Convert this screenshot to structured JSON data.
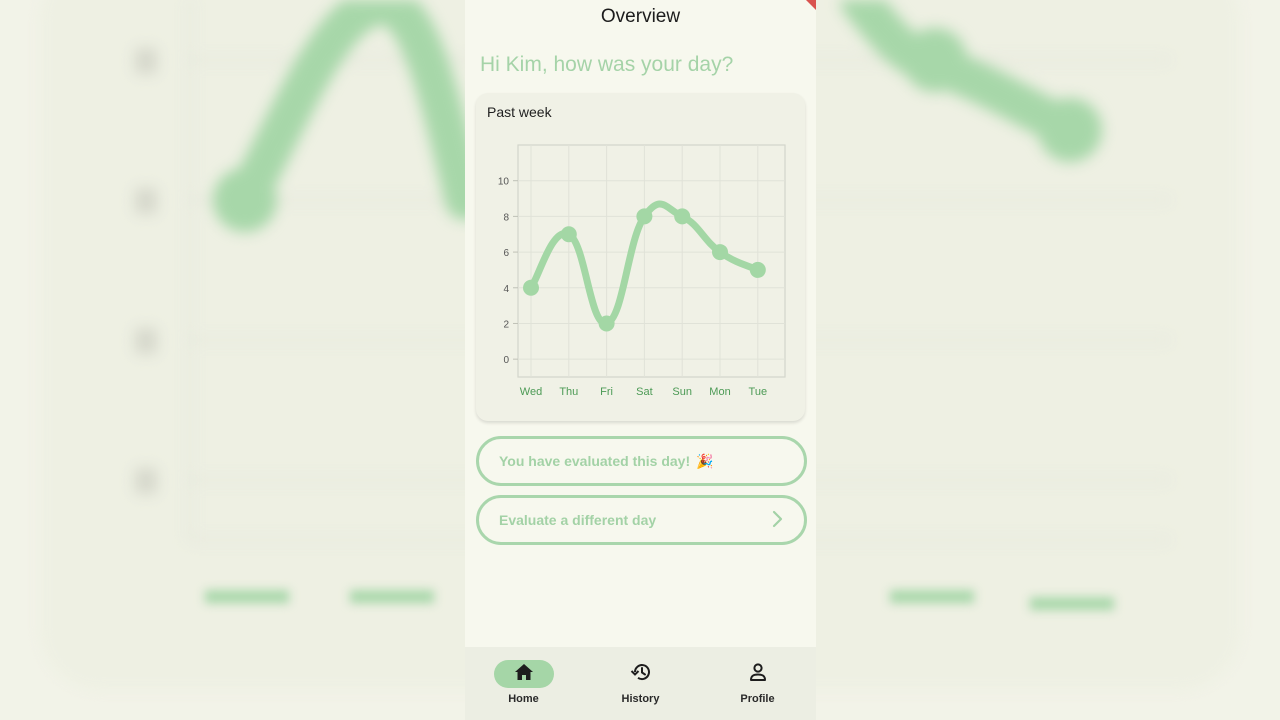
{
  "app_title": "Overview",
  "greeting": "Hi Kim, how was your day?",
  "colors": {
    "accent": "#a5d6a7",
    "line": "#a3d7a5",
    "background": "#f7f8ee"
  },
  "chart_data": {
    "type": "line",
    "title": "Past week",
    "categories": [
      "Wed",
      "Thu",
      "Fri",
      "Sat",
      "Sun",
      "Mon",
      "Tue"
    ],
    "values": [
      4,
      7,
      2,
      8,
      8,
      6,
      5
    ],
    "ylim": [
      -1,
      12
    ],
    "yticks": [
      0,
      2,
      4,
      6,
      8,
      10
    ],
    "grid": true,
    "legend": "none"
  },
  "actions": {
    "evaluated_label": "You have evaluated this day!",
    "evaluated_emoji": "🎉",
    "evaluated_icon": "party-popper-icon",
    "different_day_label": "Evaluate a different day",
    "different_day_icon": "chevron-right-icon"
  },
  "nav": {
    "items": [
      {
        "label": "Home",
        "icon": "home-icon",
        "active": true
      },
      {
        "label": "History",
        "icon": "history-icon",
        "active": false
      },
      {
        "label": "Profile",
        "icon": "person-icon",
        "active": false
      }
    ]
  }
}
